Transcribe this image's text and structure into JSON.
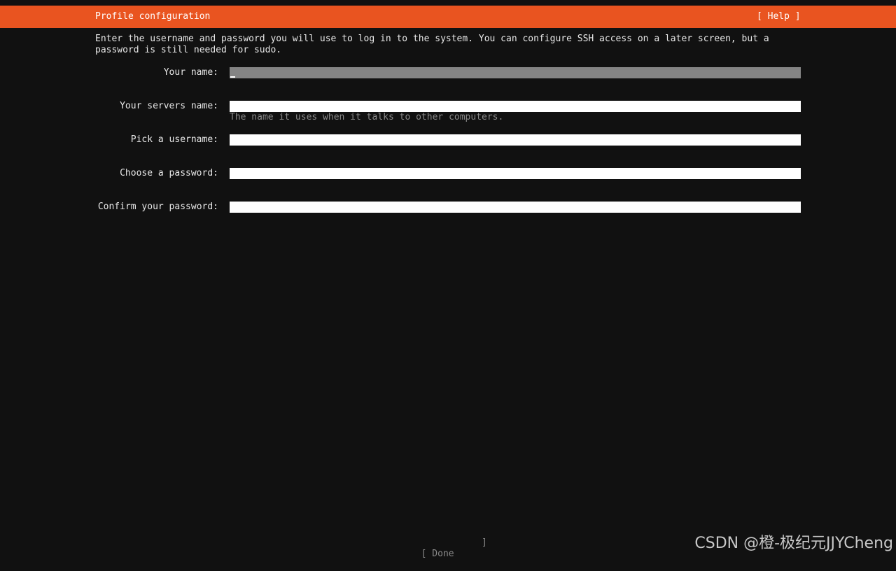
{
  "header": {
    "title": "Profile configuration",
    "help_label": "[ Help ]"
  },
  "intro": "Enter the username and password you will use to log in to the system. You can configure SSH access on a later screen, but a password is still needed for sudo.",
  "form": {
    "your_name": {
      "label": "Your name:",
      "value": ""
    },
    "server_name": {
      "label": "Your servers name:",
      "value": "",
      "hint": "The name it uses when it talks to other computers."
    },
    "username": {
      "label": "Pick a username:",
      "value": ""
    },
    "password": {
      "label": "Choose a password:",
      "value": ""
    },
    "confirm_password": {
      "label": "Confirm your password:",
      "value": ""
    }
  },
  "footer": {
    "done_open": "[ Done",
    "done_close": "]"
  },
  "watermark": "CSDN @橙-极纪元JJYCheng",
  "colors": {
    "accent": "#e95420",
    "background": "#111111",
    "focused_field": "#848484",
    "field": "#ffffff",
    "hint": "#8a8a8a"
  }
}
